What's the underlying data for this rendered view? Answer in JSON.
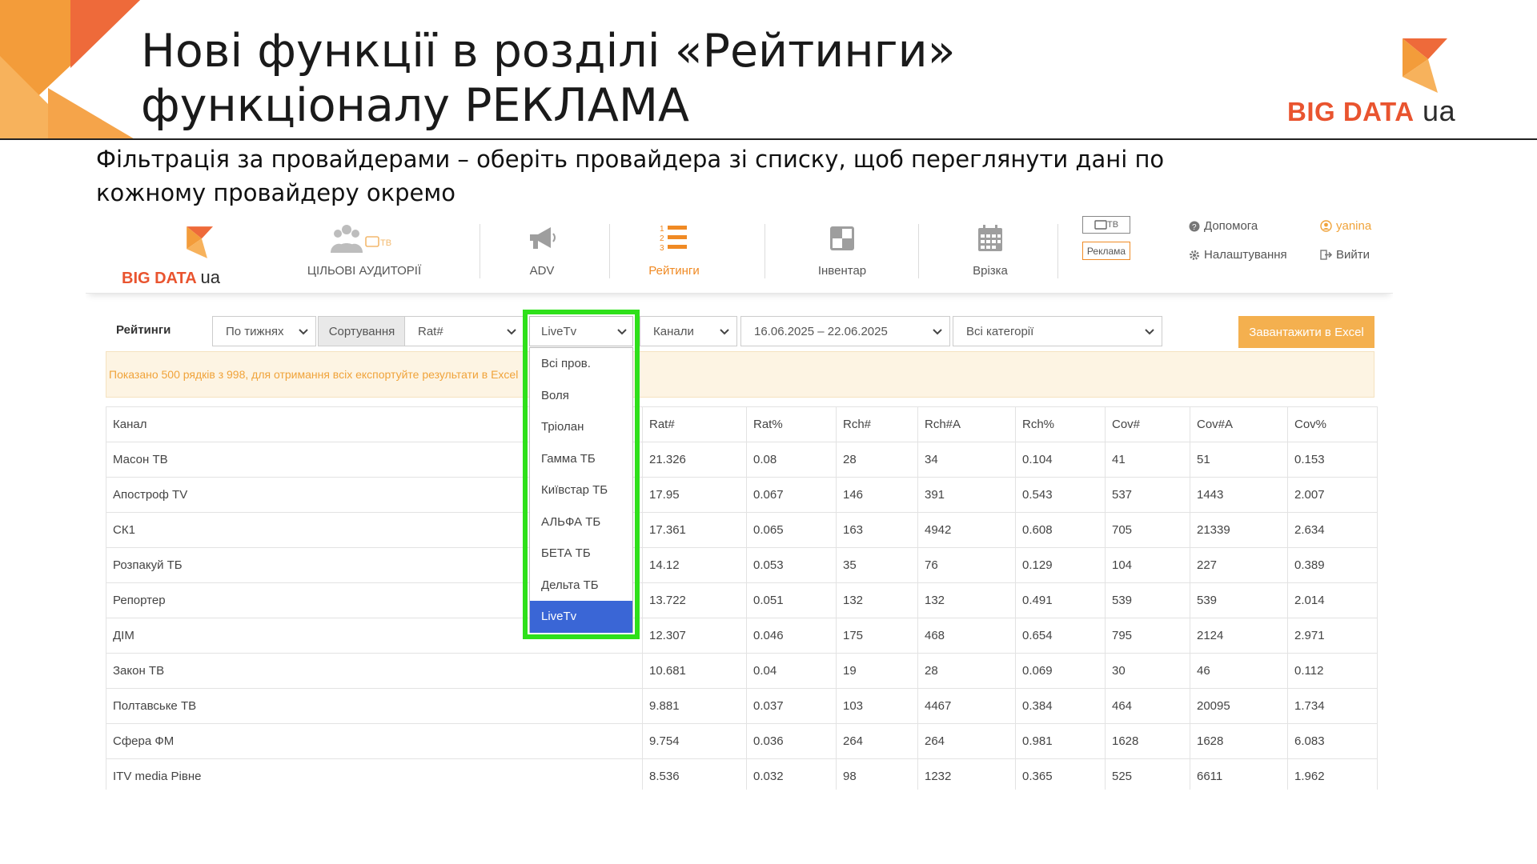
{
  "slide": {
    "title": "Нові функції в розділі «Рейтинги» функціоналу РЕКЛАМА",
    "logo_brand": "BIG DATA",
    "logo_suffix": "ua",
    "subtitle": "Фільтрація за провайдерами – оберіть провайдера зі списку, щоб переглянути дані по кожному провайдеру окремо"
  },
  "colors": {
    "accent_orange": "#f08a24",
    "brand_red": "#e9542f",
    "export_button": "#f4b04f",
    "selected_option": "#3a66d6",
    "highlight_frame": "#2ee01a"
  },
  "app": {
    "logo_brand": "BIG DATA",
    "logo_suffix": "ua",
    "nav": [
      {
        "label": "ЦІЛЬОВІ АУДИТОРІЇ",
        "icon": "people-tv-icon",
        "tv_badge": "ТВ"
      },
      {
        "label": "ADV",
        "icon": "megaphone-icon"
      },
      {
        "label": "Рейтинги",
        "icon": "ranked-list-icon",
        "active": true
      },
      {
        "label": "Інвентар",
        "icon": "inventory-icon"
      },
      {
        "label": "Врізка",
        "icon": "calendar-icon"
      }
    ],
    "tv_toggle": "ТВ",
    "ads_toggle": "Реклама",
    "help": "Допомога",
    "settings": "Налаштування",
    "user": "yanina",
    "logout": "Вийти"
  },
  "filters": {
    "label": "Рейтинги",
    "period": "По тижнях",
    "sort_label": "Сортування",
    "sort_value": "Rat#",
    "provider_selected": "LiveTv",
    "entity": "Канали",
    "date_range": "16.06.2025 – 22.06.2025",
    "category": "Всі категорії",
    "export": "Завантажити в Excel"
  },
  "notice": "Показано 500 рядків з 998, для отримання всіх експортуйте результати в Excel",
  "provider_options": [
    "Всі пров.",
    "Воля",
    "Тріолан",
    "Гамма ТБ",
    "Київстар ТБ",
    "АЛЬФА ТБ",
    "БЕТА ТБ",
    "Дельта ТБ",
    "LiveTv"
  ],
  "table": {
    "headers": [
      "Канал",
      "Rat#",
      "Rat%",
      "Rch#",
      "Rch#A",
      "Rch%",
      "Cov#",
      "Cov#A",
      "Cov%"
    ],
    "rows": [
      [
        "Масон ТВ",
        "21.326",
        "0.08",
        "28",
        "34",
        "0.104",
        "41",
        "51",
        "0.153"
      ],
      [
        "Апостроф TV",
        "17.95",
        "0.067",
        "146",
        "391",
        "0.543",
        "537",
        "1443",
        "2.007"
      ],
      [
        "СК1",
        "17.361",
        "0.065",
        "163",
        "4942",
        "0.608",
        "705",
        "21339",
        "2.634"
      ],
      [
        "Розпакуй ТБ",
        "14.12",
        "0.053",
        "35",
        "76",
        "0.129",
        "104",
        "227",
        "0.389"
      ],
      [
        "Репортер",
        "13.722",
        "0.051",
        "132",
        "132",
        "0.491",
        "539",
        "539",
        "2.014"
      ],
      [
        "ДІМ",
        "12.307",
        "0.046",
        "175",
        "468",
        "0.654",
        "795",
        "2124",
        "2.971"
      ],
      [
        "Закон ТВ",
        "10.681",
        "0.04",
        "19",
        "28",
        "0.069",
        "30",
        "46",
        "0.112"
      ],
      [
        "Полтавське ТВ",
        "9.881",
        "0.037",
        "103",
        "4467",
        "0.384",
        "464",
        "20095",
        "1.734"
      ],
      [
        "Сфера ФМ",
        "9.754",
        "0.036",
        "264",
        "264",
        "0.981",
        "1628",
        "1628",
        "6.083"
      ],
      [
        "ITV media Рівне",
        "8.536",
        "0.032",
        "98",
        "1232",
        "0.365",
        "525",
        "6611",
        "1.962"
      ]
    ]
  }
}
